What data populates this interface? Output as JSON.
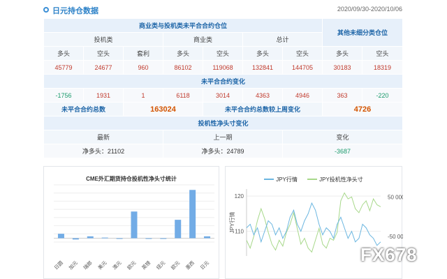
{
  "header": {
    "title": "日元持仓数据",
    "date": "2020/09/30-2020/10/06"
  },
  "table": {
    "group_header": "商业类与投机类未平合合约仓位",
    "other_header": "其他未细分类仓位",
    "categories": [
      "投机类",
      "商业类",
      "总计"
    ],
    "columns": [
      "多头",
      "空头",
      "套利",
      "多头",
      "空头",
      "多头",
      "空头",
      "多头",
      "空头"
    ],
    "positions": [
      "45779",
      "24677",
      "960",
      "86102",
      "119068",
      "132841",
      "144705",
      "30183",
      "18319"
    ],
    "change_header": "未平合合约变化",
    "changes": [
      "-1756",
      "1931",
      "1",
      "6118",
      "3014",
      "4363",
      "4946",
      "363",
      "-220"
    ],
    "total_label": "未平合合约总数",
    "total_value": "163024",
    "weekly_change_label": "未平合合约总数较上周变化",
    "weekly_change_value": "4726",
    "net_header": "投机性净头寸变化",
    "net_columns": [
      "最新",
      "上一期",
      "变化"
    ],
    "net_latest": "净多头：21102",
    "net_previous": "净多头：24789",
    "net_change": "-3687"
  },
  "bar_chart": {
    "title": "CME外汇期货持仓投机性净头寸统计",
    "bar_color": "#72ace6"
  },
  "line_chart": {
    "legend": [
      "JPY行情",
      "JPY投机性净头寸"
    ],
    "colors": [
      "#6bb6e0",
      "#a7d88a"
    ],
    "y_left_label": "JPY行情",
    "y_left_ticks": [
      "120",
      "110"
    ],
    "y_right_ticks": [
      "50 000",
      "-50 000"
    ]
  },
  "chart_data": [
    {
      "type": "bar",
      "title": "CME外汇期货持仓投机性净头寸统计",
      "categories": [
        "日圆",
        "加元",
        "瑞郎",
        "美元",
        "澳元",
        "欧元",
        "英镑",
        "纽元",
        "欧元",
        "墨西",
        "日元"
      ],
      "values": [
        3.5,
        -1,
        1.5,
        0.5,
        0,
        21,
        -0.5,
        0,
        14.5,
        38,
        1.5
      ],
      "ylim": [
        -3,
        42
      ]
    },
    {
      "type": "line",
      "series": [
        {
          "name": "JPY行情",
          "values": [
            111,
            112,
            109,
            111,
            107,
            110,
            113,
            112,
            109,
            111,
            108,
            110,
            114,
            116,
            112,
            110,
            113,
            115,
            118,
            116,
            112,
            109,
            111,
            110,
            108,
            112,
            114,
            111,
            108,
            110,
            107,
            108,
            112,
            111,
            109,
            108,
            106,
            107
          ]
        },
        {
          "name": "JPY投机性净头寸",
          "values": [
            -60000,
            -80000,
            -50000,
            -10000,
            20000,
            -5000,
            -40000,
            -70000,
            -85000,
            -60000,
            -75000,
            -40000,
            -20000,
            10000,
            -30000,
            -70000,
            -55000,
            -80000,
            -90000,
            -60000,
            -30000,
            -70000,
            -80000,
            -55000,
            -60000,
            -40000,
            40000,
            60000,
            45000,
            50000,
            20000,
            10000,
            30000,
            40000,
            15000,
            45000,
            30000,
            25000
          ]
        }
      ],
      "y_left_ticks": [
        120,
        110
      ],
      "y_right_ticks": [
        50000,
        -50000
      ]
    }
  ]
}
